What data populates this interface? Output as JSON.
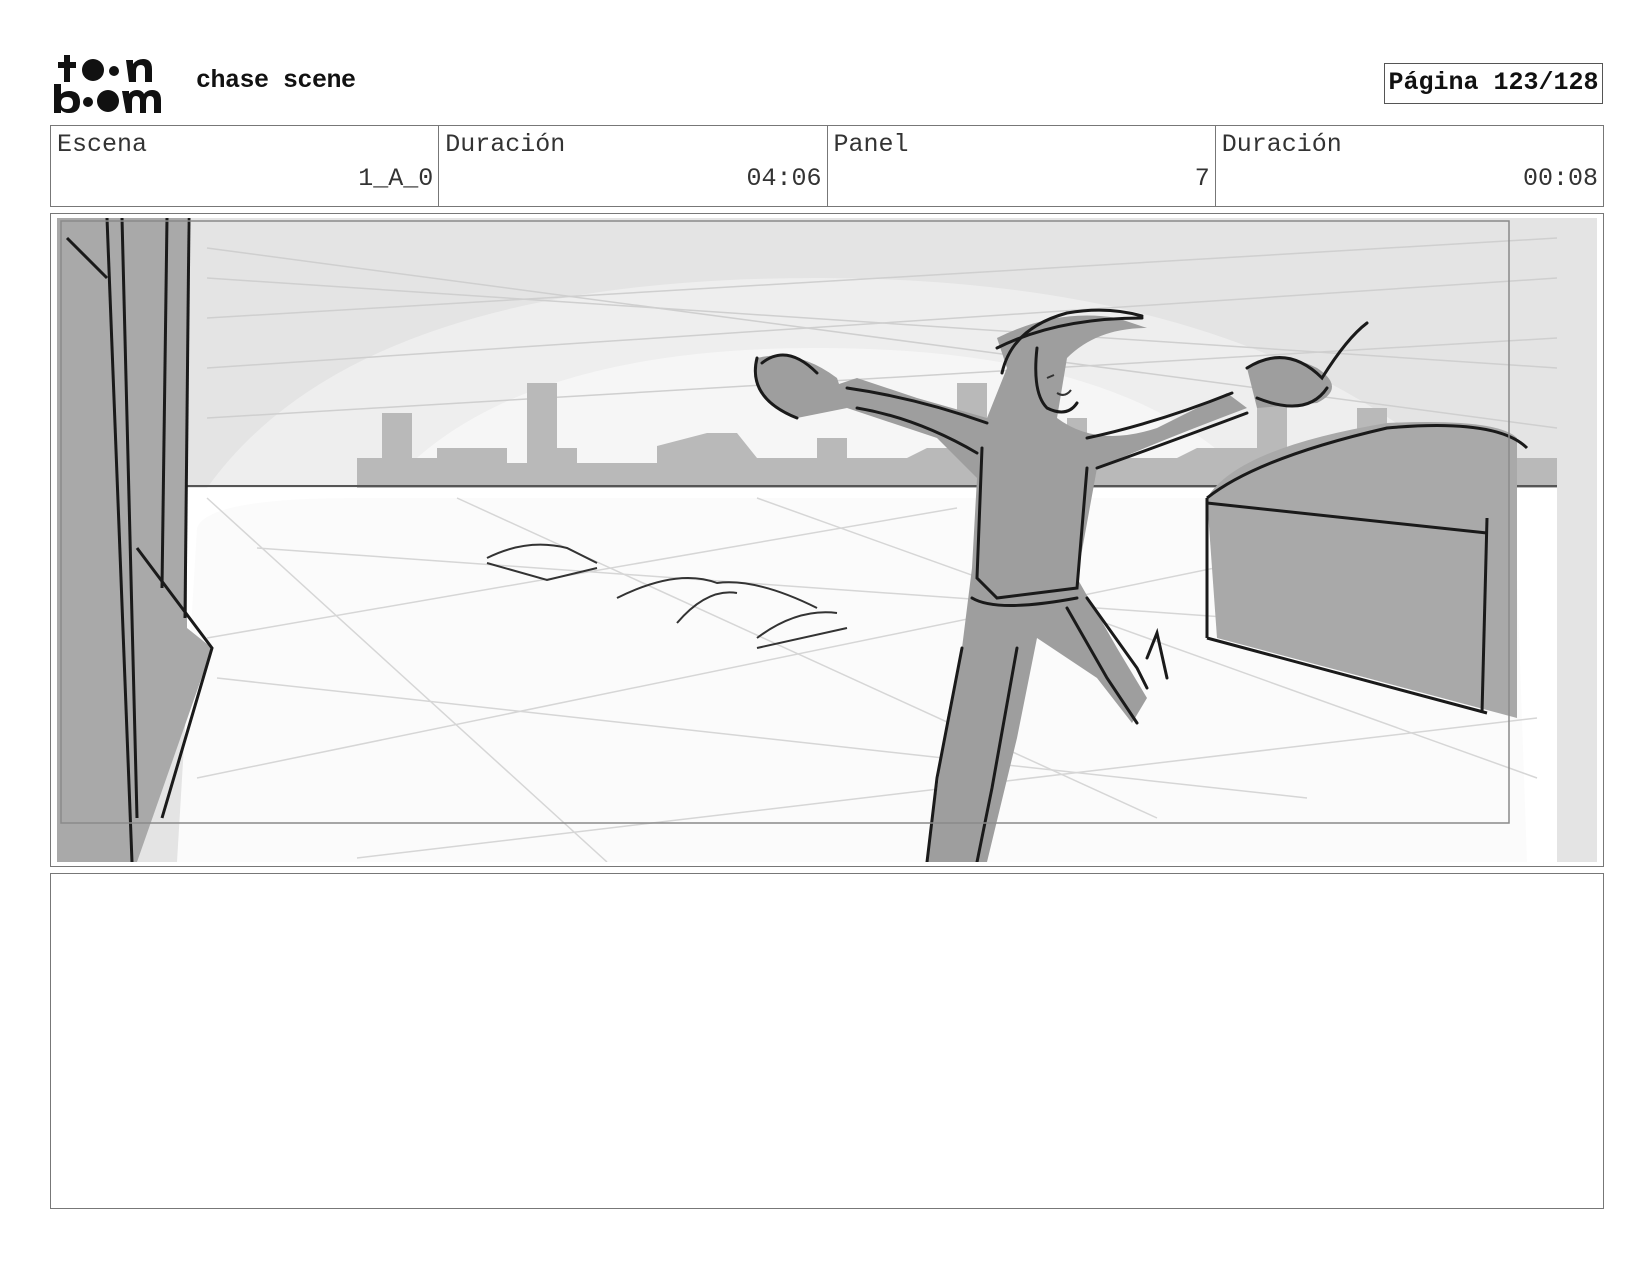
{
  "header": {
    "logo_text": "toon boom",
    "project_title": "chase scene",
    "page_label": "Página 123/128"
  },
  "info": {
    "scene_label": "Escena",
    "scene_value": "1_A_0",
    "scene_duration_label": "Duración",
    "scene_duration_value": "04:06",
    "panel_label": "Panel",
    "panel_value": "7",
    "panel_duration_label": "Duración",
    "panel_duration_value": "00:08"
  },
  "notes": {
    "text": ""
  }
}
